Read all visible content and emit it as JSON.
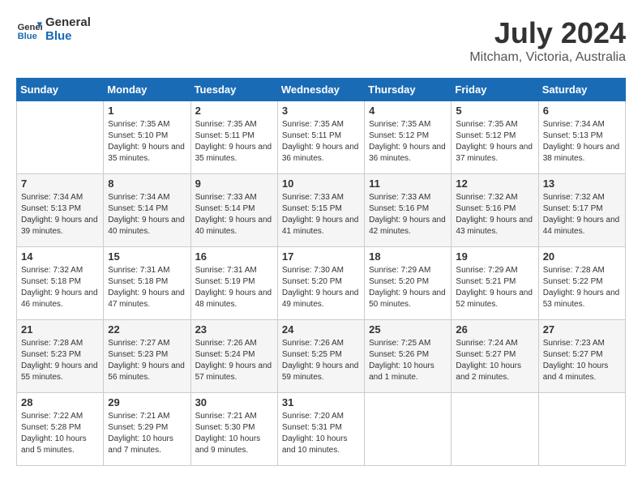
{
  "header": {
    "logo_text_general": "General",
    "logo_text_blue": "Blue",
    "month_year": "July 2024",
    "location": "Mitcham, Victoria, Australia"
  },
  "days_of_week": [
    "Sunday",
    "Monday",
    "Tuesday",
    "Wednesday",
    "Thursday",
    "Friday",
    "Saturday"
  ],
  "weeks": [
    [
      {
        "day": "",
        "sunrise": "",
        "sunset": "",
        "daylight": ""
      },
      {
        "day": "1",
        "sunrise": "Sunrise: 7:35 AM",
        "sunset": "Sunset: 5:10 PM",
        "daylight": "Daylight: 9 hours and 35 minutes."
      },
      {
        "day": "2",
        "sunrise": "Sunrise: 7:35 AM",
        "sunset": "Sunset: 5:11 PM",
        "daylight": "Daylight: 9 hours and 35 minutes."
      },
      {
        "day": "3",
        "sunrise": "Sunrise: 7:35 AM",
        "sunset": "Sunset: 5:11 PM",
        "daylight": "Daylight: 9 hours and 36 minutes."
      },
      {
        "day": "4",
        "sunrise": "Sunrise: 7:35 AM",
        "sunset": "Sunset: 5:12 PM",
        "daylight": "Daylight: 9 hours and 36 minutes."
      },
      {
        "day": "5",
        "sunrise": "Sunrise: 7:35 AM",
        "sunset": "Sunset: 5:12 PM",
        "daylight": "Daylight: 9 hours and 37 minutes."
      },
      {
        "day": "6",
        "sunrise": "Sunrise: 7:34 AM",
        "sunset": "Sunset: 5:13 PM",
        "daylight": "Daylight: 9 hours and 38 minutes."
      }
    ],
    [
      {
        "day": "7",
        "sunrise": "Sunrise: 7:34 AM",
        "sunset": "Sunset: 5:13 PM",
        "daylight": "Daylight: 9 hours and 39 minutes."
      },
      {
        "day": "8",
        "sunrise": "Sunrise: 7:34 AM",
        "sunset": "Sunset: 5:14 PM",
        "daylight": "Daylight: 9 hours and 40 minutes."
      },
      {
        "day": "9",
        "sunrise": "Sunrise: 7:33 AM",
        "sunset": "Sunset: 5:14 PM",
        "daylight": "Daylight: 9 hours and 40 minutes."
      },
      {
        "day": "10",
        "sunrise": "Sunrise: 7:33 AM",
        "sunset": "Sunset: 5:15 PM",
        "daylight": "Daylight: 9 hours and 41 minutes."
      },
      {
        "day": "11",
        "sunrise": "Sunrise: 7:33 AM",
        "sunset": "Sunset: 5:16 PM",
        "daylight": "Daylight: 9 hours and 42 minutes."
      },
      {
        "day": "12",
        "sunrise": "Sunrise: 7:32 AM",
        "sunset": "Sunset: 5:16 PM",
        "daylight": "Daylight: 9 hours and 43 minutes."
      },
      {
        "day": "13",
        "sunrise": "Sunrise: 7:32 AM",
        "sunset": "Sunset: 5:17 PM",
        "daylight": "Daylight: 9 hours and 44 minutes."
      }
    ],
    [
      {
        "day": "14",
        "sunrise": "Sunrise: 7:32 AM",
        "sunset": "Sunset: 5:18 PM",
        "daylight": "Daylight: 9 hours and 46 minutes."
      },
      {
        "day": "15",
        "sunrise": "Sunrise: 7:31 AM",
        "sunset": "Sunset: 5:18 PM",
        "daylight": "Daylight: 9 hours and 47 minutes."
      },
      {
        "day": "16",
        "sunrise": "Sunrise: 7:31 AM",
        "sunset": "Sunset: 5:19 PM",
        "daylight": "Daylight: 9 hours and 48 minutes."
      },
      {
        "day": "17",
        "sunrise": "Sunrise: 7:30 AM",
        "sunset": "Sunset: 5:20 PM",
        "daylight": "Daylight: 9 hours and 49 minutes."
      },
      {
        "day": "18",
        "sunrise": "Sunrise: 7:29 AM",
        "sunset": "Sunset: 5:20 PM",
        "daylight": "Daylight: 9 hours and 50 minutes."
      },
      {
        "day": "19",
        "sunrise": "Sunrise: 7:29 AM",
        "sunset": "Sunset: 5:21 PM",
        "daylight": "Daylight: 9 hours and 52 minutes."
      },
      {
        "day": "20",
        "sunrise": "Sunrise: 7:28 AM",
        "sunset": "Sunset: 5:22 PM",
        "daylight": "Daylight: 9 hours and 53 minutes."
      }
    ],
    [
      {
        "day": "21",
        "sunrise": "Sunrise: 7:28 AM",
        "sunset": "Sunset: 5:23 PM",
        "daylight": "Daylight: 9 hours and 55 minutes."
      },
      {
        "day": "22",
        "sunrise": "Sunrise: 7:27 AM",
        "sunset": "Sunset: 5:23 PM",
        "daylight": "Daylight: 9 hours and 56 minutes."
      },
      {
        "day": "23",
        "sunrise": "Sunrise: 7:26 AM",
        "sunset": "Sunset: 5:24 PM",
        "daylight": "Daylight: 9 hours and 57 minutes."
      },
      {
        "day": "24",
        "sunrise": "Sunrise: 7:26 AM",
        "sunset": "Sunset: 5:25 PM",
        "daylight": "Daylight: 9 hours and 59 minutes."
      },
      {
        "day": "25",
        "sunrise": "Sunrise: 7:25 AM",
        "sunset": "Sunset: 5:26 PM",
        "daylight": "Daylight: 10 hours and 1 minute."
      },
      {
        "day": "26",
        "sunrise": "Sunrise: 7:24 AM",
        "sunset": "Sunset: 5:27 PM",
        "daylight": "Daylight: 10 hours and 2 minutes."
      },
      {
        "day": "27",
        "sunrise": "Sunrise: 7:23 AM",
        "sunset": "Sunset: 5:27 PM",
        "daylight": "Daylight: 10 hours and 4 minutes."
      }
    ],
    [
      {
        "day": "28",
        "sunrise": "Sunrise: 7:22 AM",
        "sunset": "Sunset: 5:28 PM",
        "daylight": "Daylight: 10 hours and 5 minutes."
      },
      {
        "day": "29",
        "sunrise": "Sunrise: 7:21 AM",
        "sunset": "Sunset: 5:29 PM",
        "daylight": "Daylight: 10 hours and 7 minutes."
      },
      {
        "day": "30",
        "sunrise": "Sunrise: 7:21 AM",
        "sunset": "Sunset: 5:30 PM",
        "daylight": "Daylight: 10 hours and 9 minutes."
      },
      {
        "day": "31",
        "sunrise": "Sunrise: 7:20 AM",
        "sunset": "Sunset: 5:31 PM",
        "daylight": "Daylight: 10 hours and 10 minutes."
      },
      {
        "day": "",
        "sunrise": "",
        "sunset": "",
        "daylight": ""
      },
      {
        "day": "",
        "sunrise": "",
        "sunset": "",
        "daylight": ""
      },
      {
        "day": "",
        "sunrise": "",
        "sunset": "",
        "daylight": ""
      }
    ]
  ]
}
